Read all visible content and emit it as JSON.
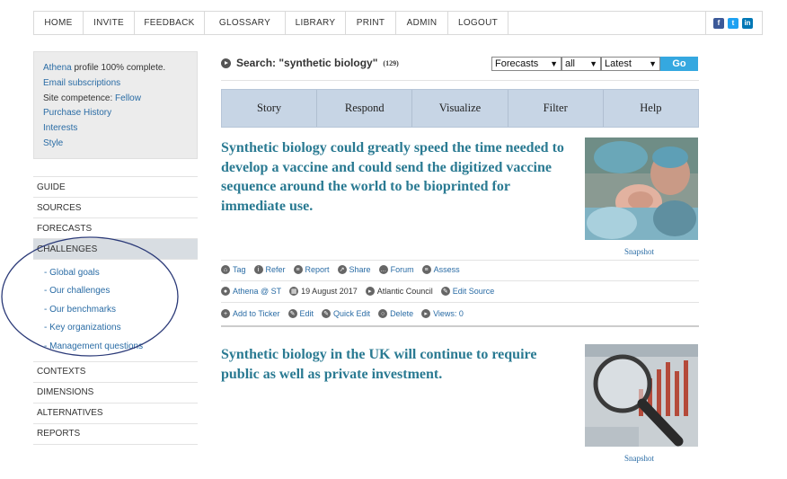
{
  "nav": {
    "items": [
      "HOME",
      "INVITE",
      "FEEDBACK",
      "GLOSSARY",
      "LIBRARY",
      "PRINT",
      "ADMIN",
      "LOGOUT"
    ],
    "social": [
      "facebook-icon",
      "twitter-icon",
      "linkedin-icon"
    ]
  },
  "profile": {
    "name": "Athena",
    "complete_text": "profile 100% complete.",
    "email_subscriptions": "Email subscriptions",
    "site_competence_label": "Site competence:",
    "site_competence_value": "Fellow",
    "purchase_history": "Purchase History",
    "interests": "Interests",
    "style": "Style"
  },
  "sidebar": {
    "guide": "GUIDE",
    "sources": "SOURCES",
    "forecasts": "FORECASTS",
    "challenges": "CHALLENGES",
    "subitems": [
      "- Global goals",
      "- Our challenges",
      "- Our benchmarks",
      "- Key organizations",
      "- Management questions"
    ],
    "contexts": "CONTEXTS",
    "dimensions": "DIMENSIONS",
    "alternatives": "ALTERNATIVES",
    "reports": "REPORTS"
  },
  "search": {
    "label": "Search: \"synthetic biology\"",
    "count": "(129)",
    "select_type": "Forecasts",
    "select_scope": "all",
    "select_sort": "Latest",
    "go": "Go"
  },
  "tabs": [
    "Story",
    "Respond",
    "Visualize",
    "Filter",
    "Help"
  ],
  "articles": [
    {
      "title": "Synthetic biology could greatly speed the time needed to develop a vaccine and could send the digitized vaccine sequence around the world to be bioprinted for immediate use.",
      "snapshot": "Snapshot",
      "actions": [
        "Tag",
        "Refer",
        "Report",
        "Share",
        "Forum",
        "Assess"
      ],
      "author": "Athena @ ST",
      "date": "19 August 2017",
      "source": "Atlantic Council",
      "edit_source": "Edit Source",
      "edit_actions": [
        "Add to Ticker",
        "Edit",
        "Quick Edit",
        "Delete"
      ],
      "views": "Views: 0"
    },
    {
      "title": "Synthetic biology in the UK will continue to require public as well as private investment.",
      "snapshot": "Snapshot"
    }
  ],
  "colors": {
    "tab_bg": "#c7d5e5",
    "title_teal": "#2a7a92",
    "link_blue": "#2a6ca5",
    "go_blue": "#35a8e0",
    "annotation_ellipse": "#2b3a78"
  }
}
